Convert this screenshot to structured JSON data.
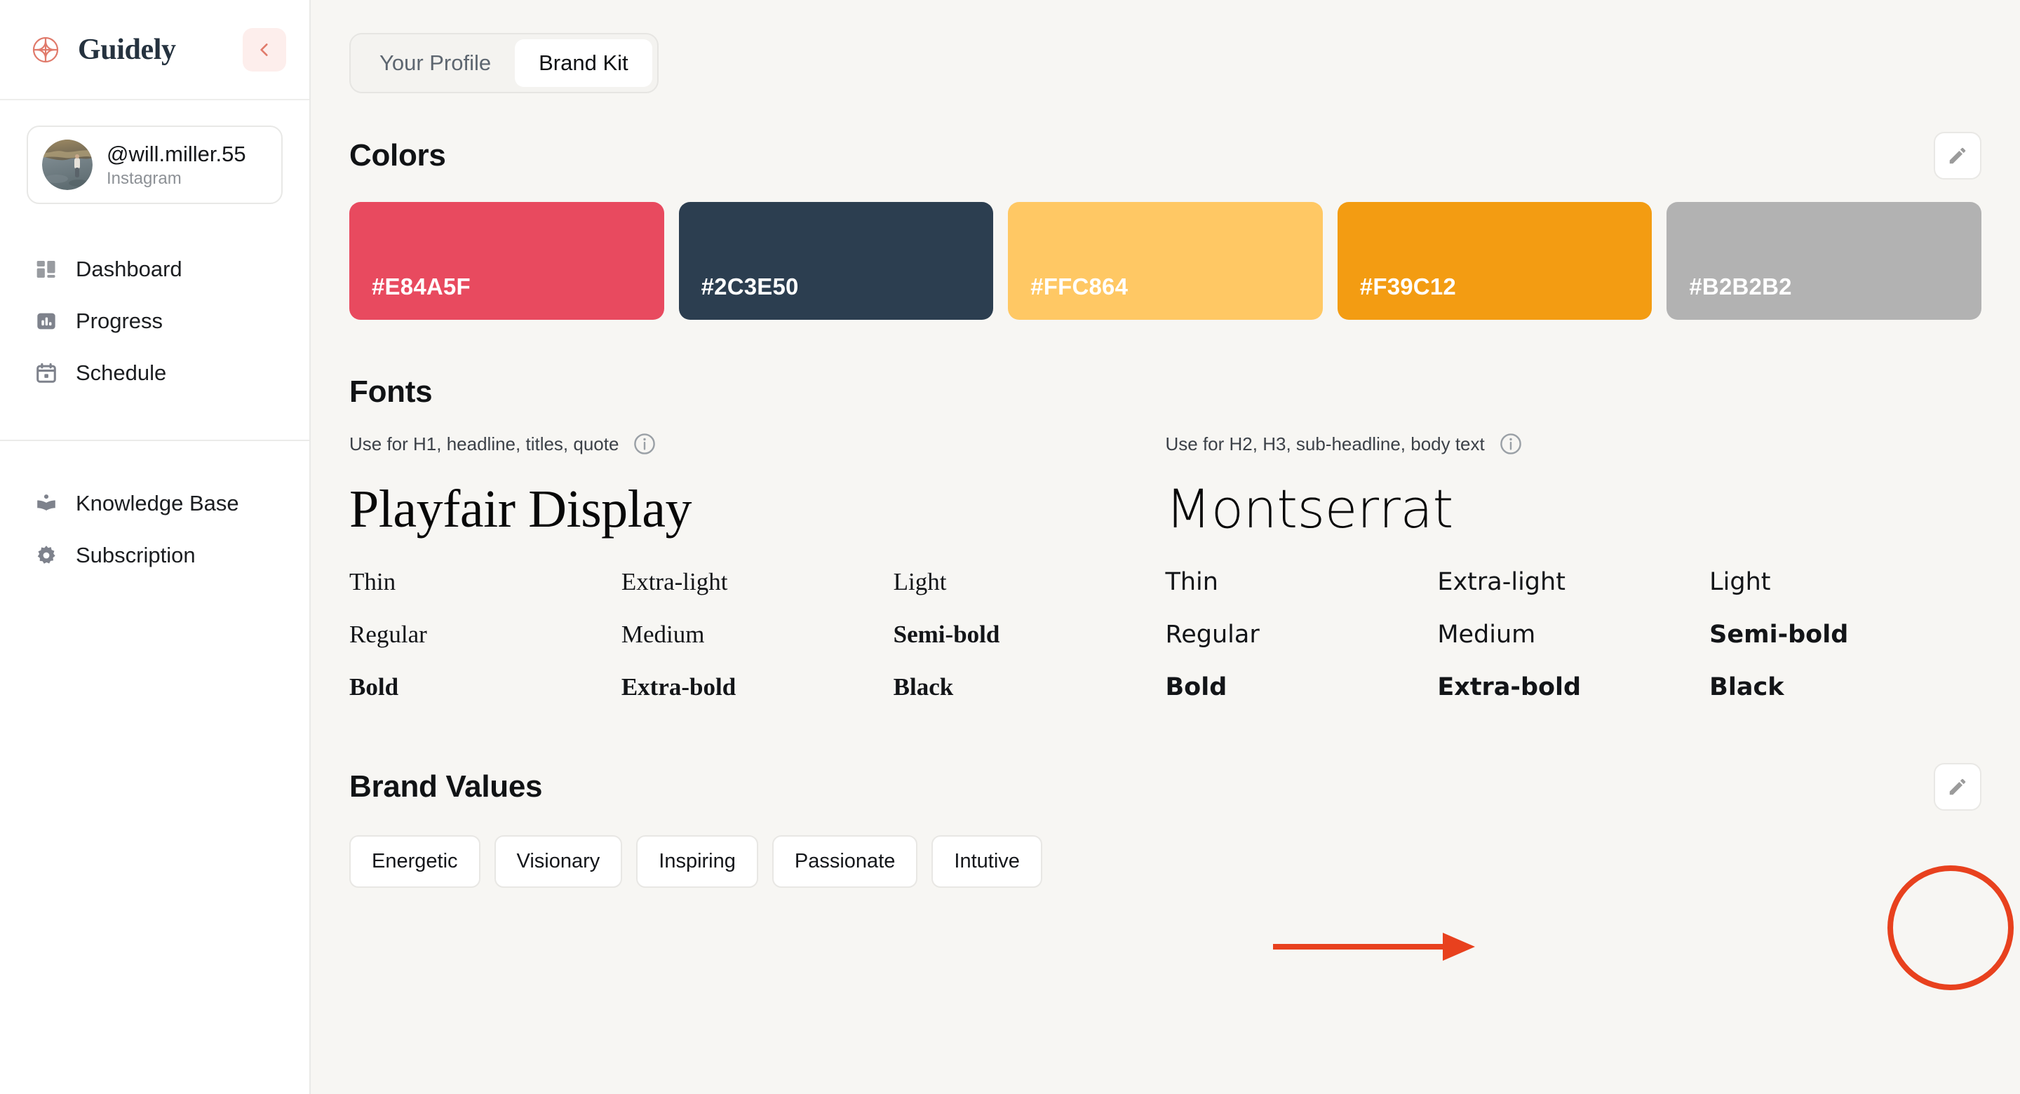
{
  "app": {
    "brand_name": "Guidely",
    "logo_icon": "compass-logo-icon",
    "collapse_icon": "chevron-left-icon",
    "accent_color": "#E07A6B",
    "collapse_bg": "#FDEEEC",
    "annotation_color": "#E8411E"
  },
  "sidebar": {
    "user": {
      "handle": "@will.miller.55",
      "platform": "Instagram",
      "avatar_icon": "user-avatar-photo"
    },
    "groups": [
      {
        "items": [
          {
            "label": "Dashboard",
            "icon": "dashboard-grid-icon"
          },
          {
            "label": "Progress",
            "icon": "bar-chart-icon"
          },
          {
            "label": "Schedule",
            "icon": "calendar-icon"
          }
        ]
      },
      {
        "items": [
          {
            "label": "Knowledge Base",
            "icon": "book-icon"
          },
          {
            "label": "Subscription",
            "icon": "gear-icon"
          }
        ]
      }
    ]
  },
  "main": {
    "tabs": [
      {
        "label": "Your Profile",
        "active": false
      },
      {
        "label": "Brand Kit",
        "active": true
      }
    ],
    "colors": {
      "title": "Colors",
      "edit_icon": "pencil-edit-icon",
      "swatches": [
        {
          "hex": "#E84A5F",
          "label": "#E84A5F"
        },
        {
          "hex": "#2C3E50",
          "label": "#2C3E50"
        },
        {
          "hex": "#FFC864",
          "label": "#FFC864"
        },
        {
          "hex": "#F39C12",
          "label": "#F39C12"
        },
        {
          "hex": "#B2B2B2",
          "label": "#B2B2B2"
        }
      ]
    },
    "fonts": {
      "title": "Fonts",
      "primary": {
        "usage": "Use for H1, headline, titles, quote",
        "info_icon": "info-circle-icon",
        "name": "Playfair Display",
        "weights": [
          "Thin",
          "Extra-light",
          "Light",
          "Regular",
          "Medium",
          "Semi-bold",
          "Bold",
          "Extra-bold",
          "Black"
        ]
      },
      "secondary": {
        "usage": "Use for H2, H3, sub-headline, body text",
        "info_icon": "info-circle-icon",
        "name": "Montserrat",
        "weights": [
          "Thin",
          "Extra-light",
          "Light",
          "Regular",
          "Medium",
          "Semi-bold",
          "Bold",
          "Extra-bold",
          "Black"
        ]
      }
    },
    "brand_values": {
      "title": "Brand Values",
      "edit_icon": "pencil-edit-icon",
      "chips": [
        "Energetic",
        "Visionary",
        "Inspiring",
        "Passionate",
        "Intutive"
      ]
    }
  }
}
